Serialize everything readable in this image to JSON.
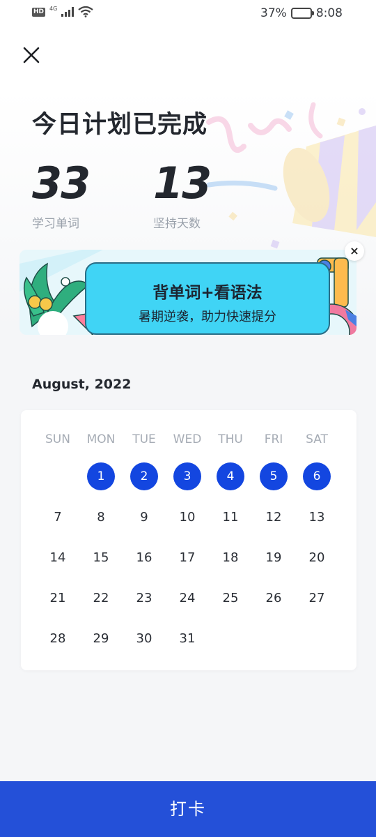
{
  "status_bar": {
    "hd": "HD",
    "network": "4G",
    "battery_percent_text": "37%",
    "battery_level": 0.37,
    "time": "8:08"
  },
  "header": {
    "close_icon": "close-icon",
    "title": "今日计划已完成"
  },
  "stats": [
    {
      "value": "33",
      "label": "学习单词"
    },
    {
      "value": "13",
      "label": "坚持天数"
    }
  ],
  "banner": {
    "title": "背单词+看语法",
    "subtitle": "暑期逆袭，助力快速提分",
    "close_label": "×",
    "colors": {
      "box": "#40d4f5",
      "background": "#e6f7fc"
    }
  },
  "calendar": {
    "month_label": "August, 2022",
    "weekdays": [
      "SUN",
      "MON",
      "TUE",
      "WED",
      "THU",
      "FRI",
      "SAT"
    ],
    "first_weekday_index": 1,
    "days_in_month": 31,
    "checked_days": [
      1,
      2,
      3,
      4,
      5,
      6
    ],
    "check_color": "#1346e0"
  },
  "footer": {
    "checkin_label": "打卡",
    "button_color": "#2450d8"
  }
}
